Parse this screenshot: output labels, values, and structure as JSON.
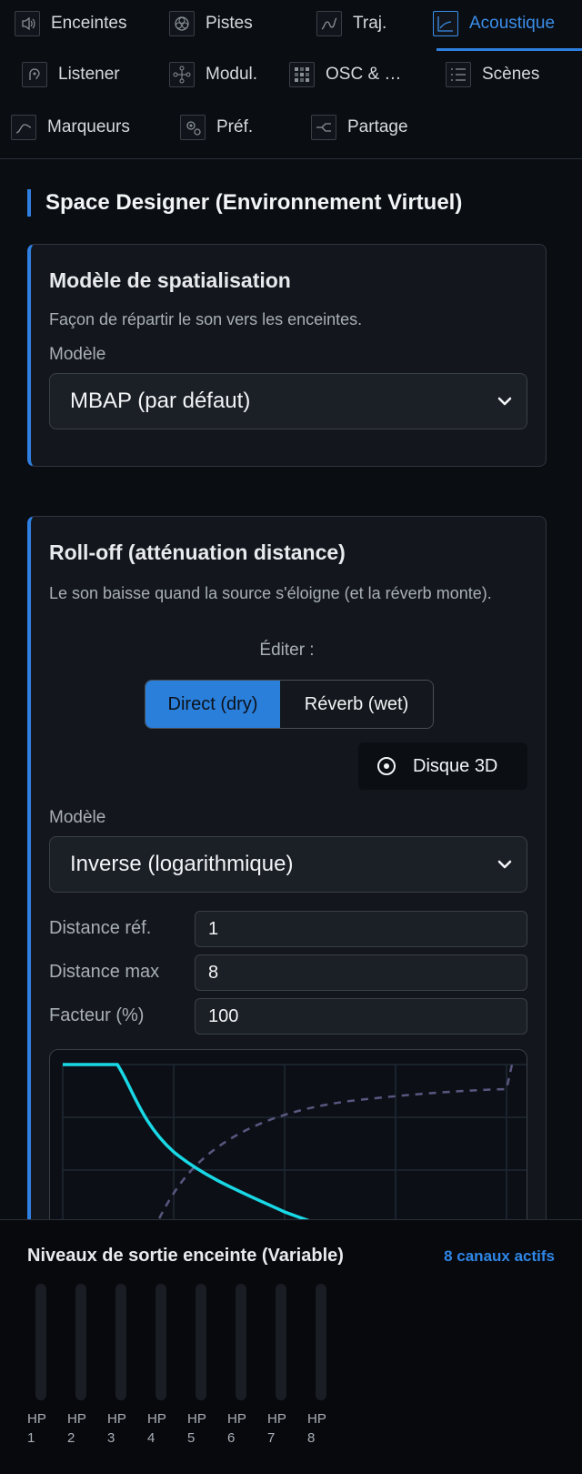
{
  "tabs": [
    {
      "label": "Enceintes",
      "icon": "speaker-icon"
    },
    {
      "label": "Pistes",
      "icon": "tracks-icon"
    },
    {
      "label": "Traj.",
      "icon": "trajectory-icon"
    },
    {
      "label": "Acoustique",
      "icon": "acoustic-icon",
      "active": true
    },
    {
      "label": "Listener",
      "icon": "listener-icon"
    },
    {
      "label": "Modul.",
      "icon": "modulation-icon"
    },
    {
      "label": "OSC & …",
      "icon": "osc-icon"
    },
    {
      "label": "Scènes",
      "icon": "scenes-icon"
    },
    {
      "label": "Marqueurs",
      "icon": "markers-icon"
    },
    {
      "label": "Préf.",
      "icon": "preferences-icon"
    },
    {
      "label": "Partage",
      "icon": "share-icon"
    }
  ],
  "section": {
    "title": "Space Designer (Environnement Virtuel)"
  },
  "spatial_model": {
    "title": "Modèle de spatialisation",
    "description": "Façon de répartir le son vers les enceintes.",
    "model_label": "Modèle",
    "model_value": "MBAP (par défaut)"
  },
  "rolloff": {
    "title": "Roll-off (atténuation distance)",
    "description": "Le son baisse quand la source s'éloigne (et la réverb monte).",
    "edit_label": "Éditer :",
    "edit_options": [
      "Direct (dry)",
      "Réverb (wet)"
    ],
    "selected_edit": "Direct (dry)",
    "disk_button": "Disque 3D",
    "model_label": "Modèle",
    "model_value": "Inverse (logarithmique)",
    "fields": [
      {
        "label": "Distance réf.",
        "value": "1"
      },
      {
        "label": "Distance max",
        "value": "8"
      },
      {
        "label": "Facteur (%)",
        "value": "100"
      }
    ]
  },
  "colors": {
    "accent": "#2f7fe0",
    "dry_curve": "#19d8e6",
    "wet_curve": "#5a5680"
  },
  "output_meters": {
    "title": "Niveaux de sortie enceinte (Variable)",
    "active_count": "8 canaux actifs",
    "channels": [
      {
        "label_top": "HP",
        "label_bottom": "1",
        "level": 0
      },
      {
        "label_top": "HP",
        "label_bottom": "2",
        "level": 0
      },
      {
        "label_top": "HP",
        "label_bottom": "3",
        "level": 0
      },
      {
        "label_top": "HP",
        "label_bottom": "4",
        "level": 0
      },
      {
        "label_top": "HP",
        "label_bottom": "5",
        "level": 0
      },
      {
        "label_top": "HP",
        "label_bottom": "6",
        "level": 0
      },
      {
        "label_top": "HP",
        "label_bottom": "7",
        "level": 0
      },
      {
        "label_top": "HP",
        "label_bottom": "8",
        "level": 0
      }
    ]
  }
}
